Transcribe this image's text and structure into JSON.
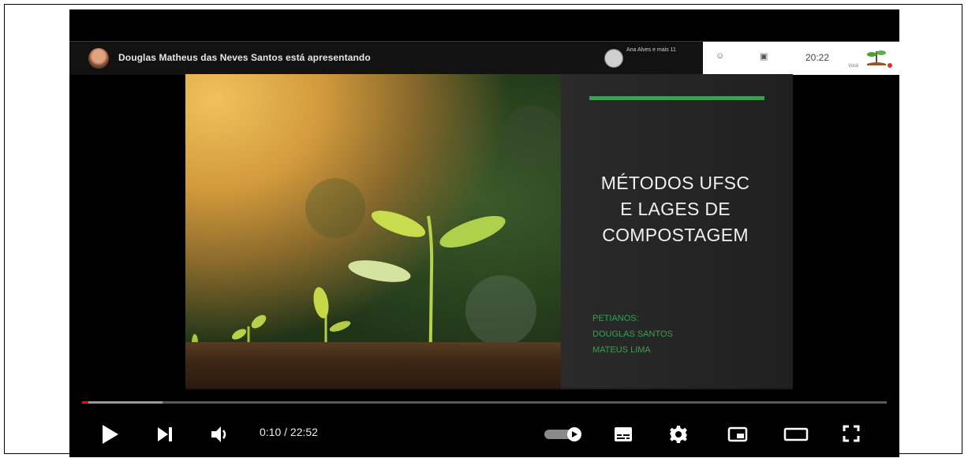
{
  "meet": {
    "presenter_text": "Douglas Matheus das Neves Santos está apresentando",
    "viewers_text": "Ana Alves e mais 11",
    "clock": "20:22",
    "tray_label": "Você"
  },
  "slide": {
    "title_lines": [
      "MÉTODOS UFSC",
      "E LAGES DE",
      "COMPOSTAGEM"
    ],
    "authors": [
      "PETIANOS:",
      "DOUGLAS SANTOS",
      "MATEUS LIMA"
    ]
  },
  "player": {
    "time_display": "0:10 / 22:52",
    "progress_fraction": 0.0074,
    "loaded_fraction": 0.1
  },
  "colors": {
    "progress_played": "#ff0000",
    "slide_accent": "#3e9e54"
  }
}
